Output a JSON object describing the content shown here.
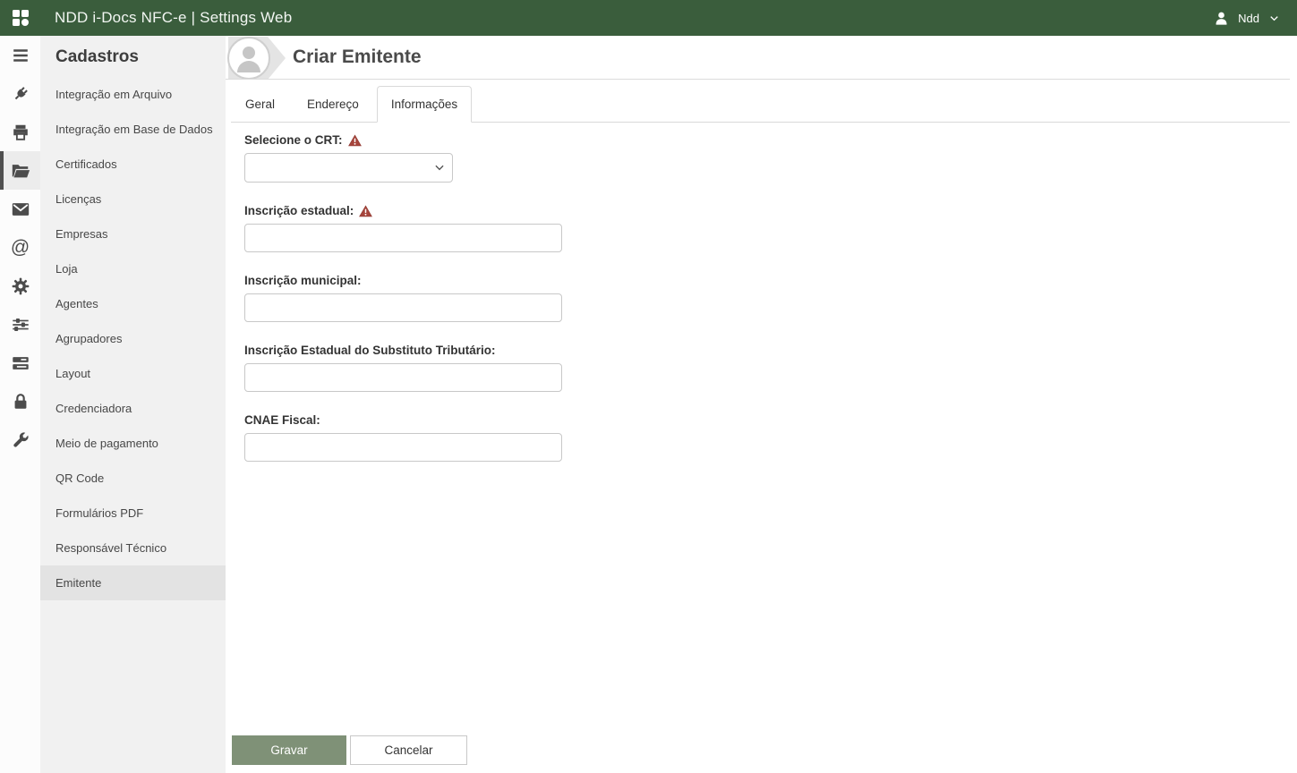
{
  "header": {
    "title": "NDD i-Docs NFC-e | Settings Web",
    "user": {
      "name": "Ndd"
    }
  },
  "rail": {
    "items": [
      {
        "icon": "menu-icon",
        "selected": false
      },
      {
        "icon": "plug-icon",
        "selected": false
      },
      {
        "icon": "printer-icon",
        "selected": false
      },
      {
        "icon": "folder-open-icon",
        "selected": true
      },
      {
        "icon": "envelope-icon",
        "selected": false
      },
      {
        "icon": "at-sign-icon",
        "selected": false
      },
      {
        "icon": "gear-icon",
        "selected": false
      },
      {
        "icon": "sliders-icon",
        "selected": false
      },
      {
        "icon": "stacked-rows-icon",
        "selected": false
      },
      {
        "icon": "lock-icon",
        "selected": false
      },
      {
        "icon": "wrench-icon",
        "selected": false
      }
    ]
  },
  "sidebar": {
    "heading": "Cadastros",
    "items": [
      {
        "label": "Integração em Arquivo",
        "selected": false
      },
      {
        "label": "Integração em Base de Dados",
        "selected": false
      },
      {
        "label": "Certificados",
        "selected": false
      },
      {
        "label": "Licenças",
        "selected": false
      },
      {
        "label": "Empresas",
        "selected": false
      },
      {
        "label": "Loja",
        "selected": false
      },
      {
        "label": "Agentes",
        "selected": false
      },
      {
        "label": "Agrupadores",
        "selected": false
      },
      {
        "label": "Layout",
        "selected": false
      },
      {
        "label": "Credenciadora",
        "selected": false
      },
      {
        "label": "Meio de pagamento",
        "selected": false
      },
      {
        "label": "QR Code",
        "selected": false
      },
      {
        "label": "Formulários PDF",
        "selected": false
      },
      {
        "label": "Responsável Técnico",
        "selected": false
      },
      {
        "label": "Emitente",
        "selected": true
      }
    ]
  },
  "main": {
    "page_title": "Criar Emitente",
    "tabs": [
      {
        "label": "Geral",
        "active": false
      },
      {
        "label": "Endereço",
        "active": false
      },
      {
        "label": "Informações",
        "active": true
      }
    ],
    "form": {
      "fields": [
        {
          "label": "Selecione o CRT:",
          "required": true,
          "type": "select",
          "value": "",
          "placeholder": ""
        },
        {
          "label": "Inscrição estadual:",
          "required": true,
          "type": "text",
          "value": "",
          "placeholder": ""
        },
        {
          "label": "Inscrição municipal:",
          "required": false,
          "type": "text",
          "value": "",
          "placeholder": ""
        },
        {
          "label": "Inscrição Estadual do Substituto Tributário:",
          "required": false,
          "type": "text",
          "value": "",
          "placeholder": ""
        },
        {
          "label": "CNAE Fiscal:",
          "required": false,
          "type": "text",
          "value": "",
          "placeholder": ""
        }
      ],
      "buttons": {
        "save": "Gravar",
        "cancel": "Cancelar"
      }
    }
  },
  "colors": {
    "header_green": "#3a5d3c",
    "primary_button_green": "#7f9177",
    "warning_red": "#a6453c",
    "sidebar_bg": "#f1f1f1",
    "selected_item_bg": "#e3e3e3"
  }
}
